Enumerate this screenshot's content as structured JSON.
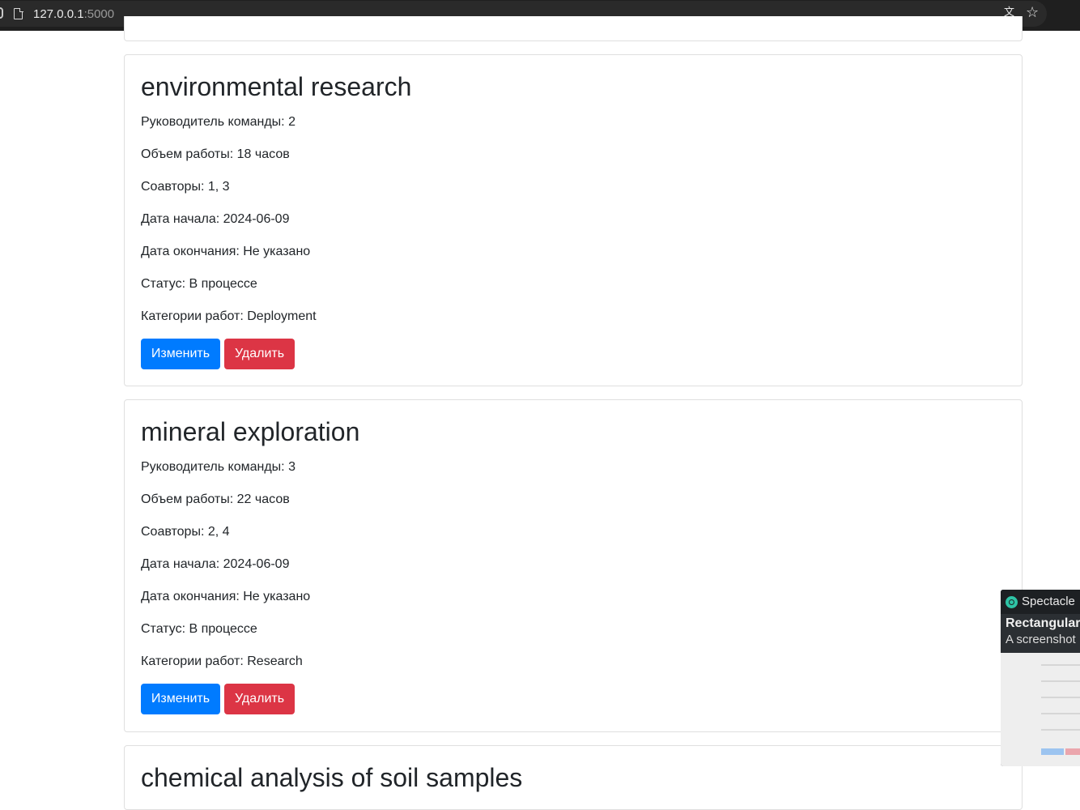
{
  "browser": {
    "url_host": "127.0.0.1",
    "url_port": ":5000",
    "translate_icon": "translate-icon",
    "bookmark_icon": "star-icon"
  },
  "labels": {
    "leader": "Руководитель команды: ",
    "work_size": "Объем работы: ",
    "collaborators": "Соавторы: ",
    "start_date": "Дата начала: ",
    "end_date": "Дата окончания: ",
    "status": "Статус: ",
    "categories": "Категории работ: ",
    "edit_button": "Изменить",
    "delete_button": "Удалить"
  },
  "jobs": [
    {
      "title": "environmental research",
      "leader": "2",
      "work_size": "18 часов",
      "collaborators": "1, 3",
      "start_date": "2024-06-09",
      "end_date": "Не указано",
      "status": "В процессе",
      "categories": "Deployment"
    },
    {
      "title": "mineral exploration",
      "leader": "3",
      "work_size": "22 часов",
      "collaborators": "2, 4",
      "start_date": "2024-06-09",
      "end_date": "Не указано",
      "status": "В процессе",
      "categories": "Research"
    },
    {
      "title": "chemical analysis of soil samples"
    }
  ],
  "notification": {
    "app_name": "Spectacle",
    "title": "Rectangular",
    "text": "A screenshot",
    "colors": {
      "accent": "#2ec4a6",
      "background": "#2b2f33"
    }
  },
  "colors": {
    "primary": "#007bff",
    "danger": "#dc3545",
    "text": "#212529",
    "border": "#dfdfdf"
  }
}
